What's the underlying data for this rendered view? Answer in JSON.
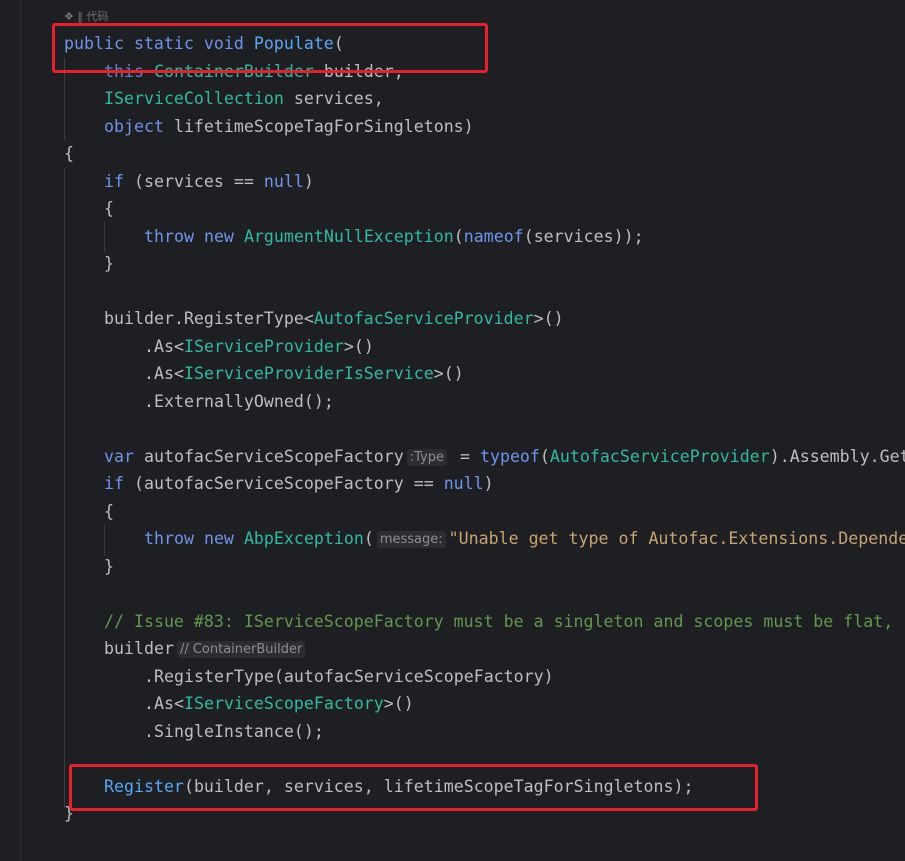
{
  "hint_top": "❖ ‖ 代码",
  "method": {
    "modifiers": [
      "public",
      "static",
      "void"
    ],
    "name": "Populate",
    "params": [
      {
        "kw": "this",
        "type": "ContainerBuilder",
        "name": "builder"
      },
      {
        "type": "IServiceCollection",
        "name": "services"
      },
      {
        "type": "object",
        "name": "lifetimeScopeTagForSingletons"
      }
    ]
  },
  "body": {
    "null_check_var": "services",
    "null_kw": "null",
    "throw_kw": "throw",
    "new_kw": "new",
    "exception1": "ArgumentNullException",
    "nameof_kw": "nameof",
    "builder_var": "builder",
    "register_type": "RegisterType",
    "autofac_provider": "AutofacServiceProvider",
    "as": "As",
    "iservice_provider": "IServiceProvider",
    "iservice_provider_is_service": "IServiceProviderIsService",
    "externally_owned": "ExternallyOwned",
    "var_kw": "var",
    "factory_var": "autofacServiceScopeFactory",
    "inlay_type": ":Type",
    "typeof_kw": "typeof",
    "assembly_tail": ".Assembly.Get",
    "if_kw": "if",
    "exception2": "AbpException",
    "inlay_message": "message:",
    "message_string": "\"Unable get type of Autofac.Extensions.Depende",
    "comment": "// Issue #83: IServiceScopeFactory must be a singleton and scopes must be flat,",
    "inlay_builder": "// ContainerBuilder",
    "iservice_scope_factory": "IServiceScopeFactory",
    "single_instance": "SingleInstance",
    "register_call": "Register",
    "lifetime_arg": "lifetimeScopeTagForSingletons"
  },
  "colors": {
    "background": "#1e1f22",
    "keyword": "#6c95eb",
    "method": "#56a8f5",
    "generic_type": "#2fbaa3",
    "string": "#c9a26d",
    "comment": "#5f9a4a",
    "highlight_box": "#e8202a"
  }
}
